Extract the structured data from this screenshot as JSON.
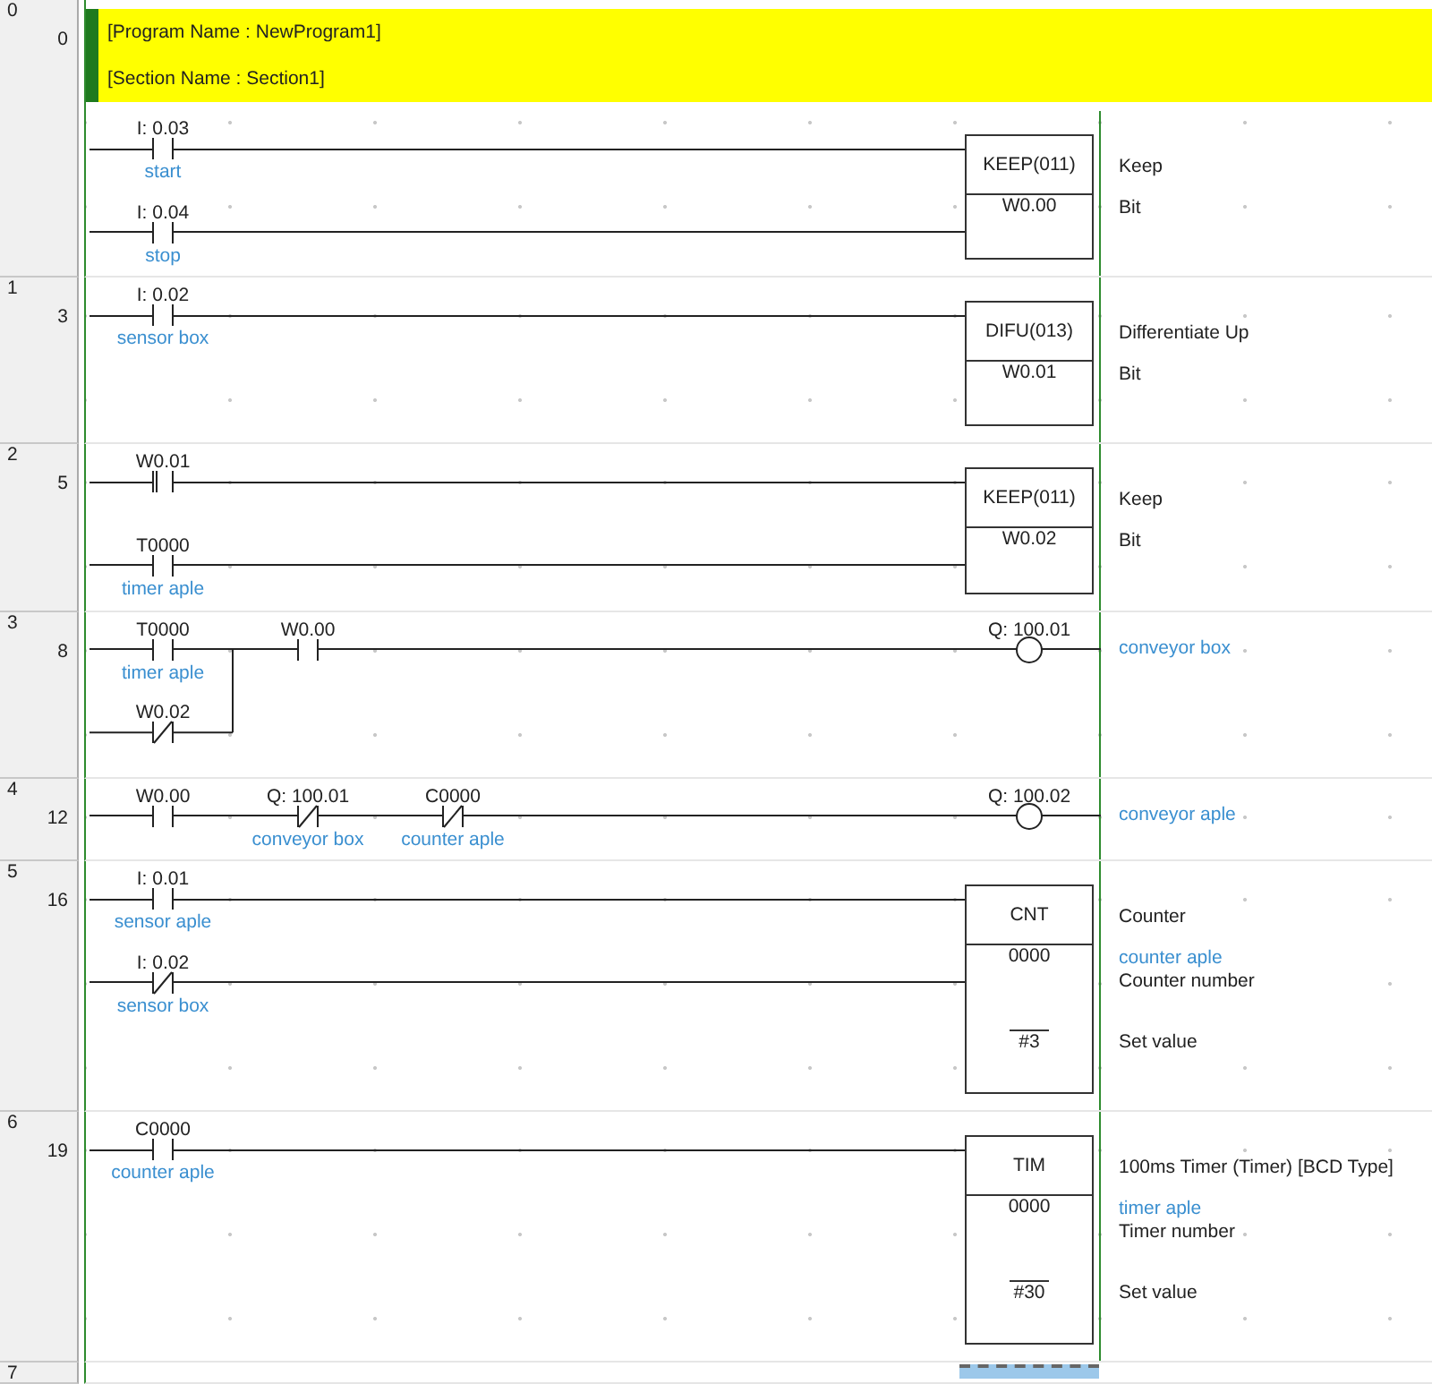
{
  "rungs": [
    {
      "number": "0",
      "step": "0",
      "header": [
        "[Program Name : NewProgram1]",
        "[Section Name : Section1]"
      ],
      "rows": [
        {
          "contacts": [
            {
              "address": "I: 0.03",
              "comment": "start",
              "kind": "no"
            }
          ]
        },
        {
          "contacts": [
            {
              "address": "I: 0.04",
              "comment": "stop",
              "kind": "no"
            }
          ]
        }
      ],
      "output": {
        "kind": "instruction",
        "mnemonic": "KEEP(011)",
        "description": "Keep",
        "operands": [
          {
            "value": "W0.00",
            "notes": [
              {
                "text": "Bit",
                "kind": "description"
              }
            ]
          }
        ]
      }
    },
    {
      "number": "1",
      "step": "3",
      "rows": [
        {
          "contacts": [
            {
              "address": "I: 0.02",
              "comment": "sensor box",
              "kind": "no"
            }
          ]
        }
      ],
      "output": {
        "kind": "instruction",
        "mnemonic": "DIFU(013)",
        "description": "Differentiate Up",
        "operands": [
          {
            "value": "W0.01",
            "notes": [
              {
                "text": "Bit",
                "kind": "description"
              }
            ]
          }
        ]
      }
    },
    {
      "number": "2",
      "step": "5",
      "rows": [
        {
          "contacts": [
            {
              "address": "W0.01",
              "kind": "up"
            }
          ]
        },
        {
          "contacts": [
            {
              "address": "T0000",
              "comment": "timer aple",
              "kind": "no"
            }
          ]
        }
      ],
      "output": {
        "kind": "instruction",
        "mnemonic": "KEEP(011)",
        "description": "Keep",
        "operands": [
          {
            "value": "W0.02",
            "notes": [
              {
                "text": "Bit",
                "kind": "description"
              }
            ]
          }
        ]
      }
    },
    {
      "number": "3",
      "step": "8",
      "rows": [
        {
          "contacts": [
            {
              "address": "T0000",
              "comment": "timer aple",
              "kind": "no"
            },
            {
              "address": "W0.00",
              "kind": "no"
            }
          ]
        },
        {
          "joins": true,
          "contacts": [
            {
              "address": "W0.02",
              "kind": "nc"
            }
          ]
        }
      ],
      "output": {
        "kind": "coil",
        "address": "Q: 100.01",
        "comment": "conveyor box"
      }
    },
    {
      "number": "4",
      "step": "12",
      "rows": [
        {
          "contacts": [
            {
              "address": "W0.00",
              "kind": "no"
            },
            {
              "address": "Q: 100.01",
              "comment": "conveyor box",
              "kind": "nc"
            },
            {
              "address": "C0000",
              "comment": "counter aple",
              "kind": "nc"
            }
          ]
        }
      ],
      "output": {
        "kind": "coil",
        "address": "Q: 100.02",
        "comment": "conveyor aple"
      }
    },
    {
      "number": "5",
      "step": "16",
      "rows": [
        {
          "contacts": [
            {
              "address": "I: 0.01",
              "comment": "sensor aple",
              "kind": "no"
            }
          ]
        },
        {
          "contacts": [
            {
              "address": "I: 0.02",
              "comment": "sensor box",
              "kind": "nc"
            }
          ]
        }
      ],
      "output": {
        "kind": "instruction",
        "mnemonic": "CNT",
        "description": "Counter",
        "operands": [
          {
            "value": "0000",
            "notes": [
              {
                "text": "counter aple",
                "kind": "comment"
              },
              {
                "text": "Counter number",
                "kind": "description"
              }
            ]
          },
          {
            "value": "#3",
            "overline": true,
            "notes": [
              {
                "text": "Set value",
                "kind": "description"
              }
            ]
          }
        ]
      }
    },
    {
      "number": "6",
      "step": "19",
      "rows": [
        {
          "contacts": [
            {
              "address": "C0000",
              "comment": "counter aple",
              "kind": "no"
            }
          ]
        }
      ],
      "output": {
        "kind": "instruction",
        "mnemonic": "TIM",
        "description": "100ms Timer (Timer) [BCD Type]",
        "operands": [
          {
            "value": "0000",
            "notes": [
              {
                "text": "timer aple",
                "kind": "comment"
              },
              {
                "text": "Timer number",
                "kind": "description"
              }
            ]
          },
          {
            "value": "#30",
            "overline": true,
            "notes": [
              {
                "text": "Set value",
                "kind": "description"
              }
            ]
          }
        ]
      }
    },
    {
      "number": "7",
      "cursor": true
    }
  ]
}
